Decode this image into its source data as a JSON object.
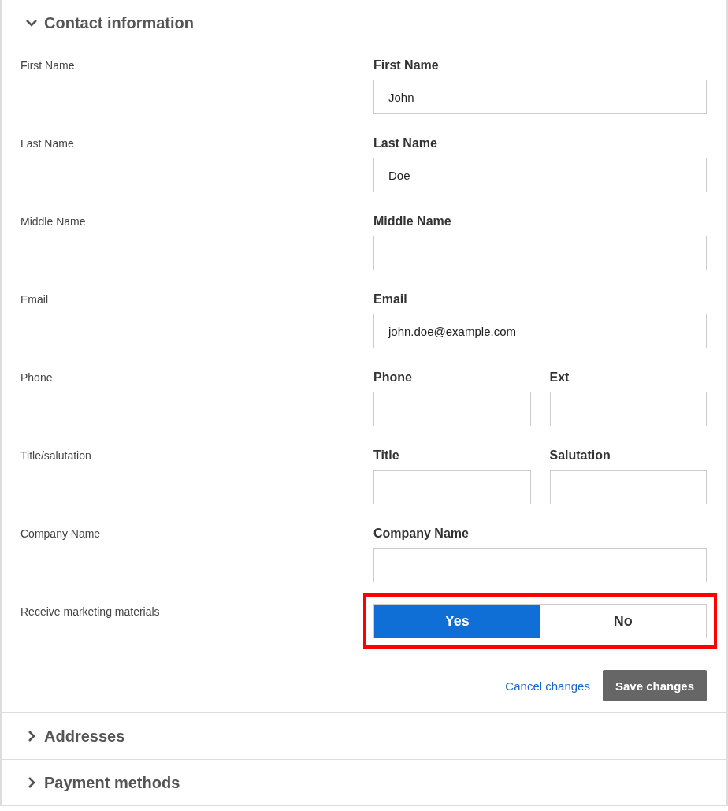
{
  "sections": [
    {
      "title": "Contact information",
      "expanded": true,
      "rows": [
        {
          "kind": "fields",
          "label": "First Name",
          "fields": [
            {
              "label": "First Name",
              "value": "John"
            }
          ]
        },
        {
          "kind": "fields",
          "label": "Last Name",
          "fields": [
            {
              "label": "Last Name",
              "value": "Doe"
            }
          ]
        },
        {
          "kind": "fields",
          "label": "Middle Name",
          "fields": [
            {
              "label": "Middle Name"
            }
          ]
        },
        {
          "kind": "fields",
          "label": "Email",
          "fields": [
            {
              "label": "Email",
              "value": "john.doe@example.com"
            }
          ]
        },
        {
          "kind": "fields",
          "label": "Phone",
          "fields": [
            {
              "label": "Phone"
            },
            {
              "label": "Ext"
            }
          ]
        },
        {
          "kind": "fields",
          "label": "Title/salutation",
          "fields": [
            {
              "label": "Title"
            },
            {
              "label": "Salutation"
            }
          ]
        },
        {
          "kind": "fields",
          "label": "Company Name",
          "fields": [
            {
              "label": "Company Name"
            }
          ]
        },
        {
          "kind": "toggle",
          "label": "Receive marketing materials",
          "highlighted": true,
          "options": [
            {
              "label": "Yes",
              "selected": true
            },
            {
              "label": "No",
              "selected": false
            }
          ]
        }
      ],
      "actions": {
        "cancel": "Cancel changes",
        "save": "Save changes"
      }
    },
    {
      "title": "Addresses",
      "expanded": false
    },
    {
      "title": "Payment methods",
      "expanded": false
    }
  ]
}
